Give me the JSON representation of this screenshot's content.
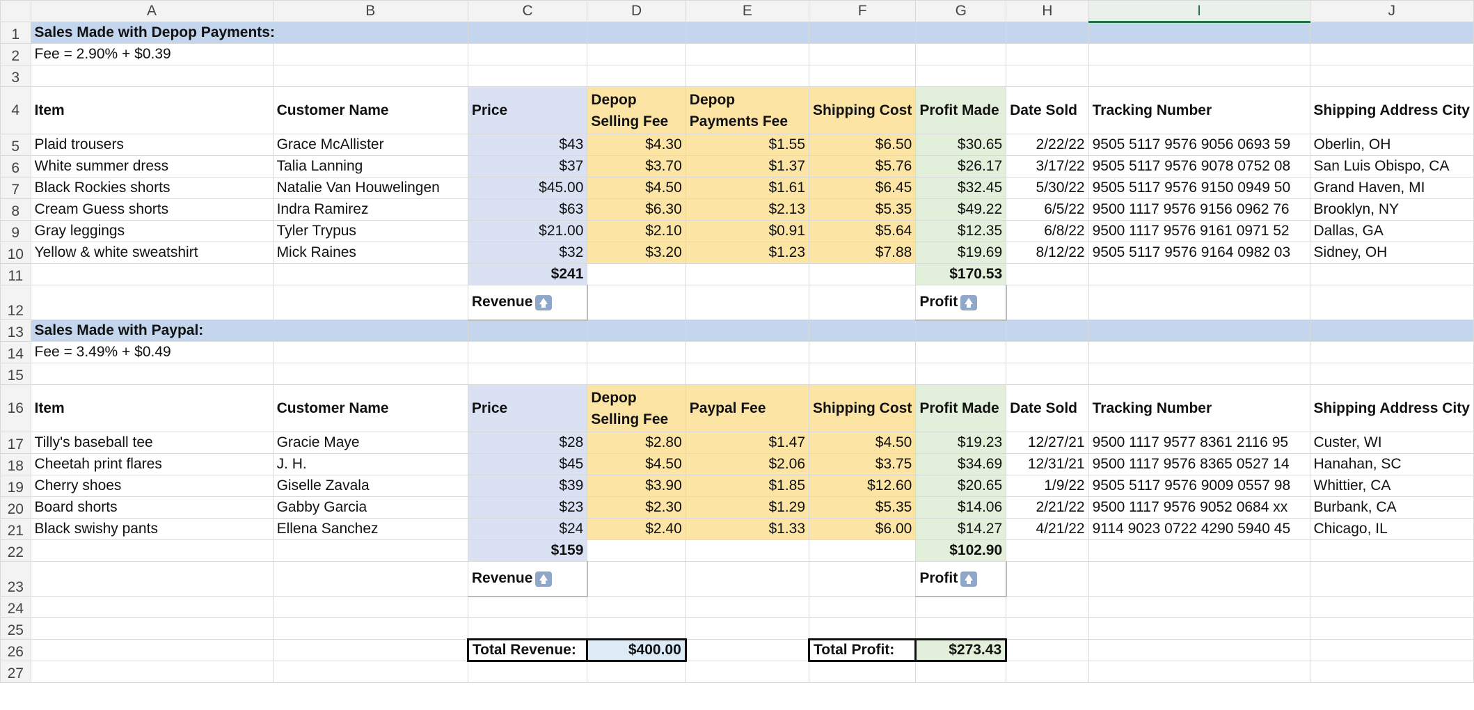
{
  "columns": [
    "A",
    "B",
    "C",
    "D",
    "E",
    "F",
    "G",
    "H",
    "I",
    "J"
  ],
  "selected_column": "I",
  "section1": {
    "title": "Sales Made with Depop Payments:",
    "fee": "Fee = 2.90% + $0.39",
    "headers": [
      "Item",
      "Customer Name",
      "Price",
      "Depop Selling Fee",
      "Depop Payments Fee",
      "Shipping Cost",
      "Profit Made",
      "Date Sold",
      "Tracking Number",
      "Shipping Address City"
    ],
    "rows": [
      [
        "Plaid trousers",
        "Grace McAllister",
        "$43",
        "$4.30",
        "$1.55",
        "$6.50",
        "$30.65",
        "2/22/22",
        "9505 5117 9576 9056 0693 59",
        "Oberlin, OH"
      ],
      [
        "White summer dress",
        "Talia Lanning",
        "$37",
        "$3.70",
        "$1.37",
        "$5.76",
        "$26.17",
        "3/17/22",
        "9505 5117 9576 9078 0752 08",
        "San Luis Obispo, CA"
      ],
      [
        "Black Rockies shorts",
        "Natalie Van Houwelingen",
        "$45.00",
        "$4.50",
        "$1.61",
        "$6.45",
        "$32.45",
        "5/30/22",
        "9505 5117 9576 9150 0949 50",
        "Grand Haven, MI"
      ],
      [
        "Cream Guess shorts",
        "Indra Ramirez",
        "$63",
        "$6.30",
        "$2.13",
        "$5.35",
        "$49.22",
        "6/5/22",
        "9500 1117 9576 9156 0962 76",
        "Brooklyn, NY"
      ],
      [
        "Gray leggings",
        "Tyler Trypus",
        "$21.00",
        "$2.10",
        "$0.91",
        "$5.64",
        "$12.35",
        "6/8/22",
        "9500 1117 9576 9161 0971 52",
        "Dallas, GA"
      ],
      [
        "Yellow & white sweatshirt",
        "Mick Raines",
        "$32",
        "$3.20",
        "$1.23",
        "$7.88",
        "$19.69",
        "8/12/22",
        "9505 5117 9576 9164 0982 03",
        "Sidney, OH"
      ]
    ],
    "total_price": "$241",
    "total_profit": "$170.53",
    "revenue_label": "Revenue",
    "profit_label": "Profit"
  },
  "section2": {
    "title": "Sales Made with Paypal:",
    "fee": "Fee = 3.49% + $0.49",
    "headers": [
      "Item",
      "Customer Name",
      "Price",
      "Depop Selling Fee",
      "Paypal Fee",
      "Shipping Cost",
      "Profit Made",
      "Date Sold",
      "Tracking Number",
      "Shipping Address City"
    ],
    "rows": [
      [
        "Tilly's baseball tee",
        "Gracie Maye",
        "$28",
        "$2.80",
        "$1.47",
        "$4.50",
        "$19.23",
        "12/27/21",
        "9500 1117 9577 8361 2116 95",
        "Custer, WI"
      ],
      [
        "Cheetah print flares",
        "J. H.",
        "$45",
        "$4.50",
        "$2.06",
        "$3.75",
        "$34.69",
        "12/31/21",
        "9500 1117 9576 8365 0527 14",
        "Hanahan, SC"
      ],
      [
        "Cherry shoes",
        "Giselle Zavala",
        "$39",
        "$3.90",
        "$1.85",
        "$12.60",
        "$20.65",
        "1/9/22",
        "9505 5117 9576 9009 0557 98",
        "Whittier, CA"
      ],
      [
        "Board shorts",
        "Gabby Garcia",
        "$23",
        "$2.30",
        "$1.29",
        "$5.35",
        "$14.06",
        "2/21/22",
        "9500 1117 9576 9052 0684 xx",
        "Burbank, CA"
      ],
      [
        "Black swishy pants",
        "Ellena Sanchez",
        "$24",
        "$2.40",
        "$1.33",
        "$6.00",
        "$14.27",
        "4/21/22",
        "9114 9023 0722 4290 5940 45",
        "Chicago, IL"
      ]
    ],
    "total_price": "$159",
    "total_profit": "$102.90",
    "revenue_label": "Revenue",
    "profit_label": "Profit"
  },
  "totals": {
    "revenue_label": "Total Revenue:",
    "revenue_value": "$400.00",
    "profit_label": "Total Profit:",
    "profit_value": "$273.43"
  },
  "row_numbers": [
    "1",
    "2",
    "3",
    "4",
    "5",
    "6",
    "7",
    "8",
    "9",
    "10",
    "11",
    "12",
    "13",
    "14",
    "15",
    "16",
    "17",
    "18",
    "19",
    "20",
    "21",
    "22",
    "23",
    "24",
    "25",
    "26",
    "27"
  ]
}
